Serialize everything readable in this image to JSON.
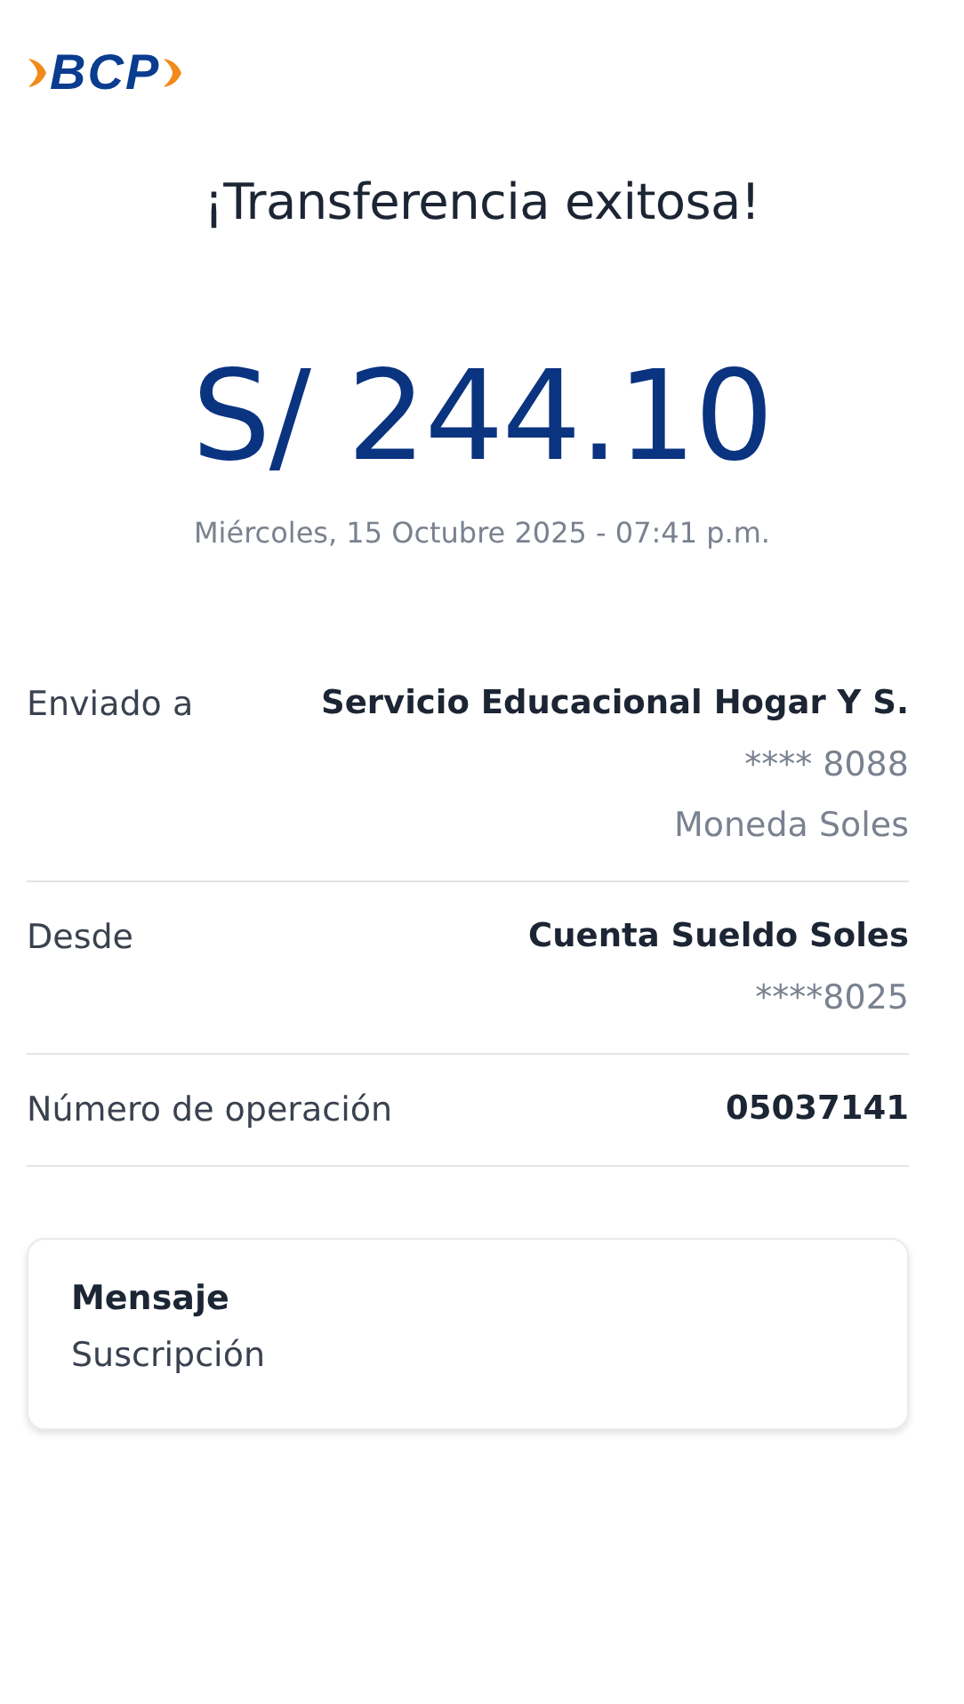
{
  "logo": {
    "text": "BCP"
  },
  "title": "¡Transferencia exitosa!",
  "amount": "S/ 244.10",
  "date": "Miércoles, 15 Octubre 2025 - 07:41 p.m.",
  "details": [
    {
      "label": "Enviado a",
      "values": [
        {
          "text": "Servicio Educacional Hogar Y S.",
          "strong": true
        },
        {
          "text": "**** 8088",
          "strong": false
        },
        {
          "text": "Moneda Soles",
          "strong": false
        }
      ]
    },
    {
      "label": "Desde",
      "values": [
        {
          "text": "Cuenta Sueldo Soles",
          "strong": true
        },
        {
          "text": "****8025",
          "strong": false
        }
      ]
    },
    {
      "label": "Número de operación",
      "values": [
        {
          "text": "05037141",
          "strong": true
        }
      ]
    }
  ],
  "message": {
    "title": "Mensaje",
    "text": "Suscripción"
  }
}
